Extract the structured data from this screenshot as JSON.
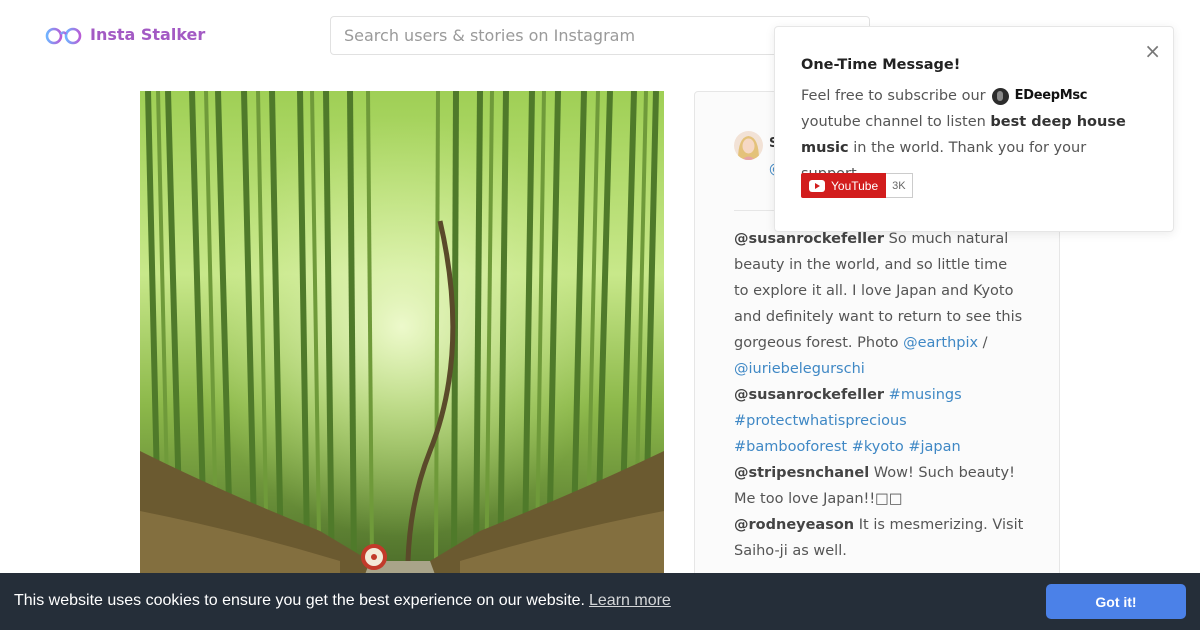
{
  "header": {
    "logo_text": "Insta Stalker",
    "logo_icon": "glasses-icon",
    "search_placeholder": "Search users & stories on Instagram"
  },
  "post": {
    "image_subject": "bamboo-forest-photo",
    "author_name": "S",
    "author_handle": "@",
    "comments": [
      {
        "user": "@susanrockefeller",
        "text": " So much natural beauty in the world, and so little time to explore it all. I love Japan and Kyoto and definitely want to return to see this gorgeous forest. Photo ",
        "tags": [
          "@earthpix",
          " / ",
          "@iuriebelegurschi"
        ]
      },
      {
        "user": "@susanrockefeller",
        "text": " ",
        "tags": [
          "#musings",
          " ",
          "#protectwhatisprecious",
          " ",
          "#bambooforest",
          " ",
          "#kyoto",
          " ",
          "#japan"
        ]
      },
      {
        "user": "@stripesnchanel",
        "text": " Wow! Such beauty! Me too love Japan!!□□",
        "tags": []
      },
      {
        "user": "@rodneyeason",
        "text": " It is mesmerizing. Visit Saiho-ji as well.",
        "tags": []
      }
    ]
  },
  "popup": {
    "title": "One-Time Message!",
    "text_before": "Feel free to subscribe our",
    "channel_name": "EDeepMsc",
    "text_after": "youtube channel to listen",
    "bold_text": "best deep house music",
    "text_end": "in the world. Thank you for your support.",
    "close_label": "×",
    "youtube_label": "YouTube",
    "youtube_count": "3K"
  },
  "cookie": {
    "message": "This website uses cookies to ensure you get the best experience on our website.",
    "learn_more": "Learn more",
    "button_label": "Got it!"
  },
  "colors": {
    "brand": "#a35ac4",
    "link": "#3f88c5",
    "cookie_bg": "#252e39",
    "cookie_button": "#4b81e8",
    "youtube_red": "#d21d1d"
  }
}
